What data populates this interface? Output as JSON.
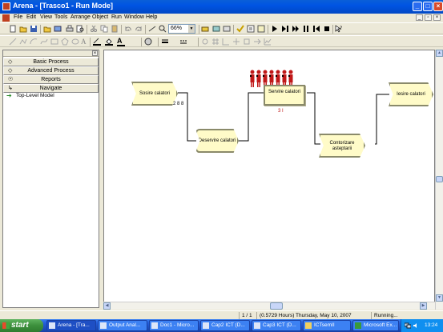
{
  "window": {
    "title": "Arena - [Trasco1 - Run Mode]"
  },
  "menu": [
    "File",
    "Edit",
    "View",
    "Tools",
    "Arrange",
    "Object",
    "Run",
    "Window",
    "Help"
  ],
  "toolbar": {
    "zoom": "66%"
  },
  "panel": {
    "bars": [
      {
        "label": "Basic Process"
      },
      {
        "label": "Advanced Process"
      },
      {
        "label": "Reports"
      },
      {
        "label": "Navigate"
      }
    ],
    "tree_item": "Top-Level Model"
  },
  "modules": {
    "sosire": "Sosire calatori",
    "deservire": "Deservire calatori",
    "servire": "Servire calatori",
    "contorizare": "Contorizare asteptarii",
    "iesire": "Iesire calatori"
  },
  "counters": {
    "sosire": "2 8 8",
    "servire": "3 I"
  },
  "status": {
    "page": "1 / 1",
    "time": "(0.5729 Hours) Thursday, May 10, 2007",
    "state": "Running..."
  },
  "taskbar": {
    "start": "start",
    "tasks": [
      {
        "label": "Arena - [Tra..."
      },
      {
        "label": "Output Anal..."
      },
      {
        "label": "Doc1 - Micro..."
      },
      {
        "label": "Cap2 ICT (D..."
      },
      {
        "label": "Cap3 ICT (D..."
      },
      {
        "label": "ICTsemII"
      },
      {
        "label": "Microsoft Ex..."
      }
    ],
    "clock": "13:24"
  }
}
